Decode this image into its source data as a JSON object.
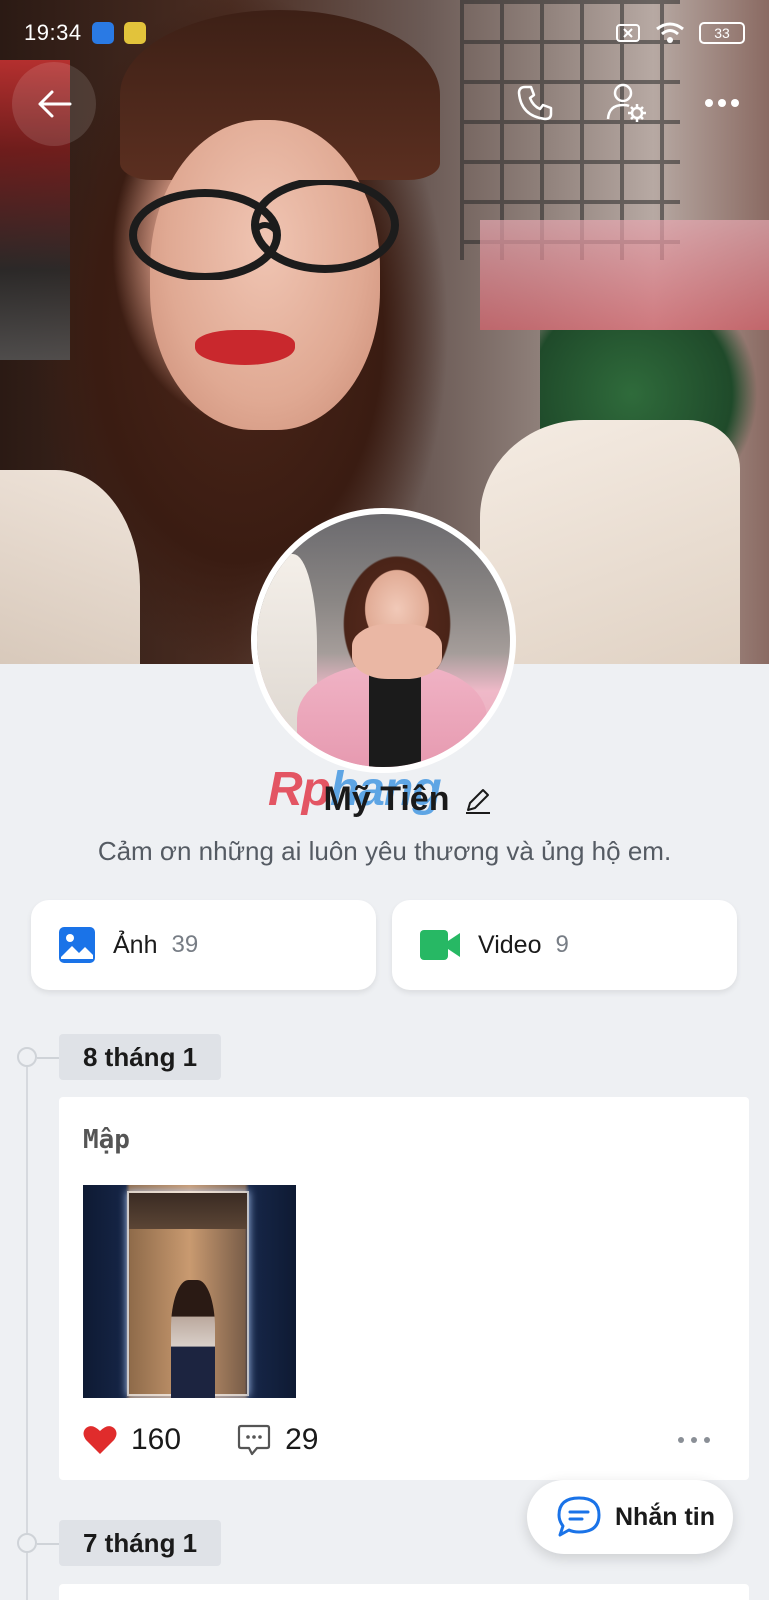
{
  "status_bar": {
    "time": "19:34",
    "battery": "33",
    "icons": [
      "home-app-icon",
      "coin-app-icon",
      "sim-x-icon",
      "wifi-icon",
      "battery-icon"
    ]
  },
  "top_bar": {
    "back": "back-arrow-icon",
    "actions": [
      "phone-icon",
      "user-settings-icon",
      "more-icon"
    ]
  },
  "profile": {
    "name": "Mỹ Tiên",
    "bio": "Cảm ơn những ai luôn yêu thương và ủng hộ em.",
    "watermark_a": "Rp",
    "watermark_b": "hang"
  },
  "media_tabs": [
    {
      "label": "Ảnh",
      "count": "39",
      "icon": "image-icon",
      "color": "#1a73e8"
    },
    {
      "label": "Video",
      "count": "9",
      "icon": "video-icon",
      "color": "#27b864"
    }
  ],
  "timeline": [
    {
      "date": "8 tháng 1",
      "post": {
        "text": "Mập",
        "likes": "160",
        "comments": "29"
      }
    },
    {
      "date": "7 tháng 1"
    }
  ],
  "fab": {
    "label": "Nhắn tin"
  },
  "colors": {
    "accent": "#1a73e8",
    "like": "#e02c2c",
    "background": "#eef0f3"
  }
}
